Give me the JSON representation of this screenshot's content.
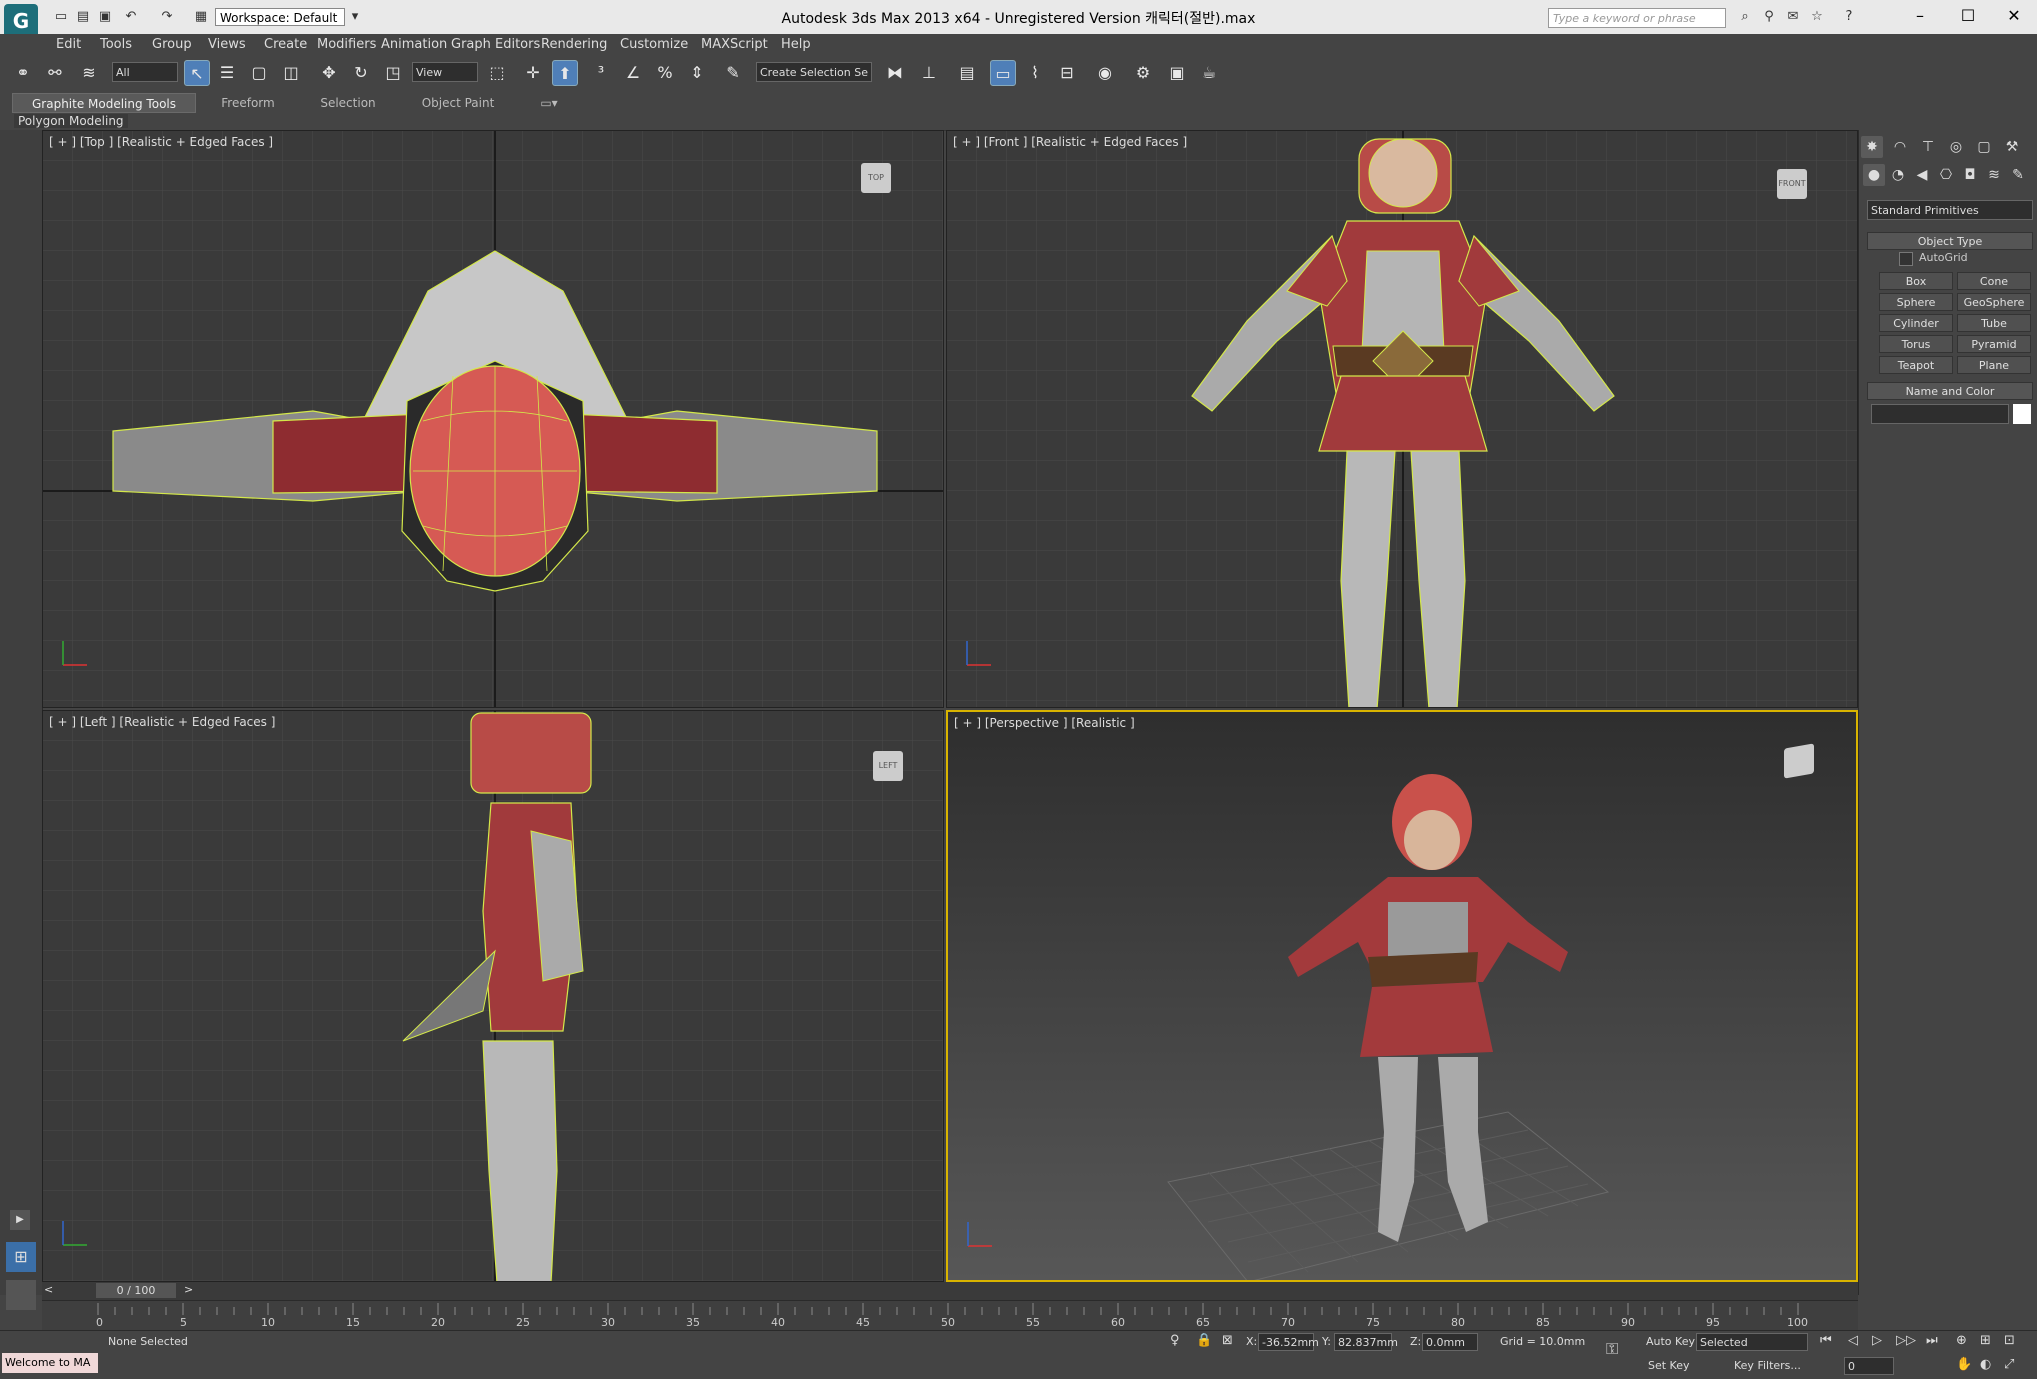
{
  "window": {
    "title": "Autodesk 3ds Max  2013 x64   - Unregistered Version      캐릭터(절반).max",
    "workspace": "Workspace: Default",
    "search_placeholder": "Type a keyword or phrase",
    "minimize": "–",
    "maximize": "☐",
    "close": "✕"
  },
  "menu": [
    "Edit",
    "Tools",
    "Group",
    "Views",
    "Create",
    "Modifiers",
    "Animation",
    "Graph Editors",
    "Rendering",
    "Customize",
    "MAXScript",
    "Help"
  ],
  "toolbar": {
    "filter": "All",
    "ref_coord": "View",
    "selection_set": "Create Selection Se"
  },
  "ribbon": {
    "tabs": [
      "Graphite Modeling Tools",
      "Freeform",
      "Selection",
      "Object Paint"
    ],
    "panel_label": "Polygon Modeling"
  },
  "viewports": {
    "top": "[ + ] [Top ] [Realistic + Edged Faces ]",
    "front": "[ + ] [Front ] [Realistic + Edged Faces ]",
    "left": "[ + ] [Left ] [Realistic + Edged Faces ]",
    "perspective": "[ + ] [Perspective ] [Realistic ]",
    "cube_top": "TOP",
    "cube_front": "FRONT",
    "cube_left": "LEFT"
  },
  "command_panel": {
    "dropdown": "Standard Primitives",
    "object_type": "Object Type",
    "autogrid": "AutoGrid",
    "buttons": [
      "Box",
      "Cone",
      "Sphere",
      "GeoSphere",
      "Cylinder",
      "Tube",
      "Torus",
      "Pyramid",
      "Teapot",
      "Plane"
    ],
    "name_color": "Name and Color"
  },
  "timeline": {
    "frame": "0 / 100",
    "ticks": [
      "0",
      "5",
      "10",
      "15",
      "20",
      "25",
      "30",
      "35",
      "40",
      "45",
      "50",
      "55",
      "60",
      "65",
      "70",
      "75",
      "80",
      "85",
      "90",
      "95",
      "100"
    ]
  },
  "status": {
    "welcome": "Welcome to MA",
    "selection": "None Selected",
    "x_label": "X:",
    "x_value": "-36.52mm",
    "y_label": "Y:",
    "y_value": "82.837mm",
    "z_label": "Z:",
    "z_value": "0.0mm",
    "grid": "Grid = 10.0mm",
    "auto_key": "Auto Key",
    "set_key": "Set Key",
    "key_mode": "Selected",
    "key_filters": "Key Filters...",
    "frame_field": "0"
  }
}
